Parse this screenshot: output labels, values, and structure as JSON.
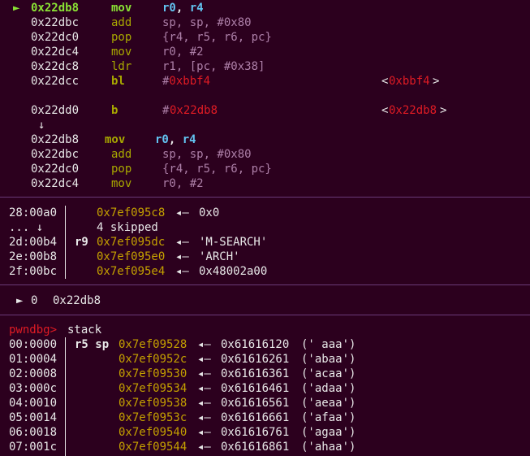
{
  "disasm_block1": [
    {
      "marker": "►",
      "addr": "0x22db8",
      "mnem": "mov",
      "ops": [
        {
          "t": "r0",
          "c": "cyan"
        },
        {
          "t": ", ",
          "c": "white"
        },
        {
          "t": "r4",
          "c": "cyan"
        }
      ],
      "current": true
    },
    {
      "marker": "",
      "addr": "0x22dbc",
      "mnem": "add",
      "ops": [
        {
          "t": "sp, sp, #0x80",
          "c": "purple"
        }
      ]
    },
    {
      "marker": "",
      "addr": "0x22dc0",
      "mnem": "pop",
      "ops": [
        {
          "t": "{r4, r5, r6, pc}",
          "c": "purple"
        }
      ]
    },
    {
      "marker": "",
      "addr": "0x22dc4",
      "mnem": "mov",
      "ops": [
        {
          "t": "r0, #2",
          "c": "purple"
        }
      ]
    },
    {
      "marker": "",
      "addr": "0x22dc8",
      "mnem": "ldr",
      "ops": [
        {
          "t": "r1, [pc, #0x38]",
          "c": "purple"
        }
      ]
    },
    {
      "marker": "",
      "addr": "0x22dcc",
      "mnem": "bl",
      "ops": [
        {
          "t": "#",
          "c": "purple"
        },
        {
          "t": "0xbbf4",
          "c": "red"
        }
      ],
      "target": "0xbbf4",
      "mnem_bold": true
    }
  ],
  "disasm_branch": {
    "addr": "0x22dd0",
    "mnem": "b",
    "op_hash": "#",
    "op_target": "0x22db8",
    "target": "0x22db8"
  },
  "down_arrow": "↓",
  "disasm_block2": [
    {
      "addr": "0x22db8",
      "mnem": "mov",
      "ops": [
        {
          "t": "r0",
          "c": "cyan"
        },
        {
          "t": ", ",
          "c": "white"
        },
        {
          "t": "r4",
          "c": "cyan"
        }
      ],
      "bold": true
    },
    {
      "addr": "0x22dbc",
      "mnem": "add",
      "ops": [
        {
          "t": "sp, sp, #0x80",
          "c": "purple"
        }
      ]
    },
    {
      "addr": "0x22dc0",
      "mnem": "pop",
      "ops": [
        {
          "t": "{r4, r5, r6, pc}",
          "c": "purple"
        }
      ]
    },
    {
      "addr": "0x22dc4",
      "mnem": "mov",
      "ops": [
        {
          "t": "r0, #2",
          "c": "purple"
        }
      ]
    }
  ],
  "stack_top": [
    {
      "off": "28:00a0",
      "reg": "",
      "addr": "0x7ef095c8",
      "val": "0x0"
    },
    {
      "off": "... ↓",
      "reg": "",
      "addr": "",
      "val": "",
      "note": "4 skipped"
    },
    {
      "off": "2d:00b4",
      "reg": "r9",
      "addr": "0x7ef095dc",
      "val": "'M-SEARCH'"
    },
    {
      "off": "2e:00b8",
      "reg": "",
      "addr": "0x7ef095e0",
      "val": "'ARCH'"
    },
    {
      "off": "2f:00bc",
      "reg": "",
      "addr": "0x7ef095e4",
      "val": "0x48002a00"
    }
  ],
  "backtrace": {
    "marker": "►",
    "frame": "0",
    "addr": "0x22db8"
  },
  "prompt": {
    "name": "pwndbg>",
    "command": "stack"
  },
  "stack_cmd": [
    {
      "off": "00:0000",
      "reg": "r5 sp",
      "addr": "0x7ef09528",
      "val": "0x61616120",
      "str": "(' aaa')"
    },
    {
      "off": "01:0004",
      "reg": "",
      "addr": "0x7ef0952c",
      "val": "0x61616261",
      "str": "('abaa')"
    },
    {
      "off": "02:0008",
      "reg": "",
      "addr": "0x7ef09530",
      "val": "0x61616361",
      "str": "('acaa')"
    },
    {
      "off": "03:000c",
      "reg": "",
      "addr": "0x7ef09534",
      "val": "0x61616461",
      "str": "('adaa')"
    },
    {
      "off": "04:0010",
      "reg": "",
      "addr": "0x7ef09538",
      "val": "0x61616561",
      "str": "('aeaa')"
    },
    {
      "off": "05:0014",
      "reg": "",
      "addr": "0x7ef0953c",
      "val": "0x61616661",
      "str": "('afaa')"
    },
    {
      "off": "06:0018",
      "reg": "",
      "addr": "0x7ef09540",
      "val": "0x61616761",
      "str": "('agaa')"
    },
    {
      "off": "07:001c",
      "reg": "",
      "addr": "0x7ef09544",
      "val": "0x61616861",
      "str": "('ahaa')"
    }
  ],
  "arrow_left": "◂—",
  "colors": {
    "background": "#2c001e",
    "green": "#8ae234",
    "olive": "#a8a800",
    "cyan": "#62c2f0",
    "purple": "#ad7fa8",
    "red": "#e01b24",
    "yellow": "#c4a000"
  }
}
